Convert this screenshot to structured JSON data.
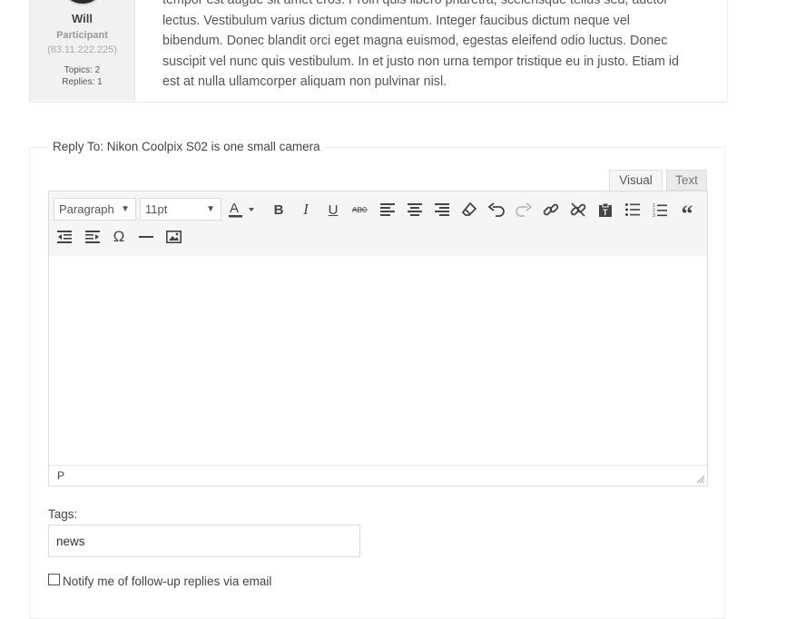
{
  "reply": {
    "author_name": "Will",
    "author_role": "Participant",
    "author_ip": "(83.11.222.225)",
    "topics": "Topics: 2",
    "replies": "Replies: 1",
    "content_lines": [
      "tempor est augue sit amet eros. Proin quis libero pharetra, scelerisque tellus sed, auctor",
      "lectus. Vestibulum varius dictum condimentum. Integer faucibus dictum neque vel",
      "bibendum. Donec blandit orci eget magna euismod, egestas eleifend odio luctus. Donec",
      "suscipit vel nunc quis vestibulum. In et justo non urna tempor tristique eu in justo. Etiam id",
      "est at nulla ullamcorper aliquam non pulvinar nisl."
    ]
  },
  "form": {
    "legend": "Reply To: Nikon Coolpix S02 is one small camera",
    "tabs": {
      "visual": "Visual",
      "text": "Text"
    },
    "toolbar": {
      "format_value": "Paragraph",
      "size_value": "11pt",
      "icons": [
        "text-color-icon",
        "bold-icon",
        "italic-icon",
        "underline-icon",
        "strikethrough-icon",
        "align-left-icon",
        "align-center-icon",
        "align-right-icon",
        "clear-formatting-icon",
        "undo-icon",
        "redo-icon",
        "link-icon",
        "unlink-icon",
        "paste-icon",
        "bullet-list-icon",
        "numbered-list-icon",
        "blockquote-icon",
        "outdent-icon",
        "indent-icon",
        "special-character-icon",
        "horizontal-rule-icon",
        "insert-image-icon"
      ]
    },
    "status_path": "P",
    "tags_label": "Tags:",
    "tags_value": "news",
    "notify_label": "Notify me of follow-up replies via email"
  },
  "colors": {
    "toolbar_bg": "#f5f5f5",
    "author_bg": "#f1f1f1",
    "text": "#555555"
  }
}
